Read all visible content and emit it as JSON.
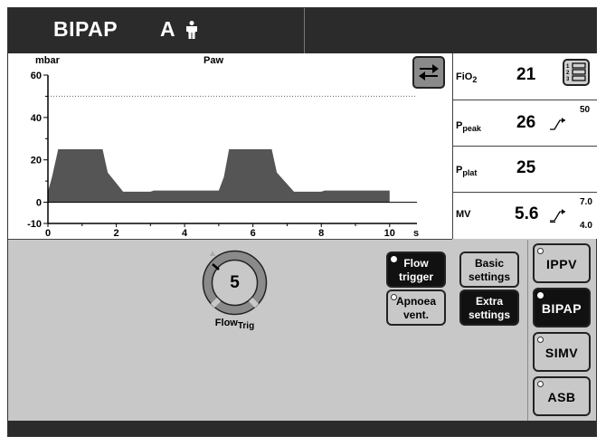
{
  "header": {
    "mode": "BIPAP",
    "sub_mode": "A"
  },
  "waveform": {
    "y_unit": "mbar",
    "signal_label": "Paw",
    "x_unit": "s",
    "y_ticks": [
      "60",
      "40",
      "20",
      "0",
      "-10"
    ],
    "x_ticks": [
      "0",
      "2",
      "4",
      "6",
      "8",
      "10"
    ]
  },
  "chart_data": {
    "type": "area",
    "title": "",
    "signal_label": "Paw",
    "ylabel": "mbar",
    "xlabel": "s",
    "xlim": [
      0,
      10.8
    ],
    "ylim": [
      -10,
      60
    ],
    "x_ticks": [
      0,
      2,
      4,
      6,
      8,
      10
    ],
    "y_ticks": [
      60,
      40,
      20,
      0,
      -10
    ],
    "threshold_line": 50,
    "x": [
      0,
      0.12,
      0.3,
      1.6,
      1.75,
      2.2,
      3.0,
      3.1,
      5.0,
      5.15,
      5.3,
      6.55,
      6.7,
      7.2,
      8.0,
      8.1,
      10.0
    ],
    "y": [
      5,
      12,
      25,
      25,
      14,
      5,
      5,
      5.5,
      5.5,
      12,
      25,
      25,
      14,
      5,
      5,
      5.5,
      5.5
    ]
  },
  "parameters": [
    {
      "label": "FiO",
      "label_sub": "2",
      "value": "21"
    },
    {
      "label": "P",
      "label_sub": "peak",
      "value": "26",
      "upper_limit": "50"
    },
    {
      "label": "P",
      "label_sub": "plat",
      "value": "25"
    },
    {
      "label": "MV",
      "label_sub": "",
      "value": "5.6",
      "upper_limit": "7.0",
      "lower_limit": "4.0"
    }
  ],
  "list_button": {
    "items": [
      "1",
      "2",
      "3"
    ]
  },
  "knob": {
    "value": "5",
    "label": "Flow",
    "label_sub": "Trig"
  },
  "buttons": {
    "flow_trigger": [
      "Flow",
      "trigger"
    ],
    "apnoea_vent": [
      "Apnoea",
      "vent."
    ],
    "basic_settings": [
      "Basic",
      "settings"
    ],
    "extra_settings": [
      "Extra",
      "settings"
    ]
  },
  "modes": [
    {
      "label": "IPPV",
      "active": false
    },
    {
      "label": "BIPAP",
      "active": true
    },
    {
      "label": "SIMV",
      "active": false
    },
    {
      "label": "ASB",
      "active": false
    }
  ],
  "colors": {
    "screen_bg": "#c8c8c8",
    "bar_bg": "#2b2b2b",
    "wave_fill": "#555555",
    "active_button": "#111111"
  }
}
